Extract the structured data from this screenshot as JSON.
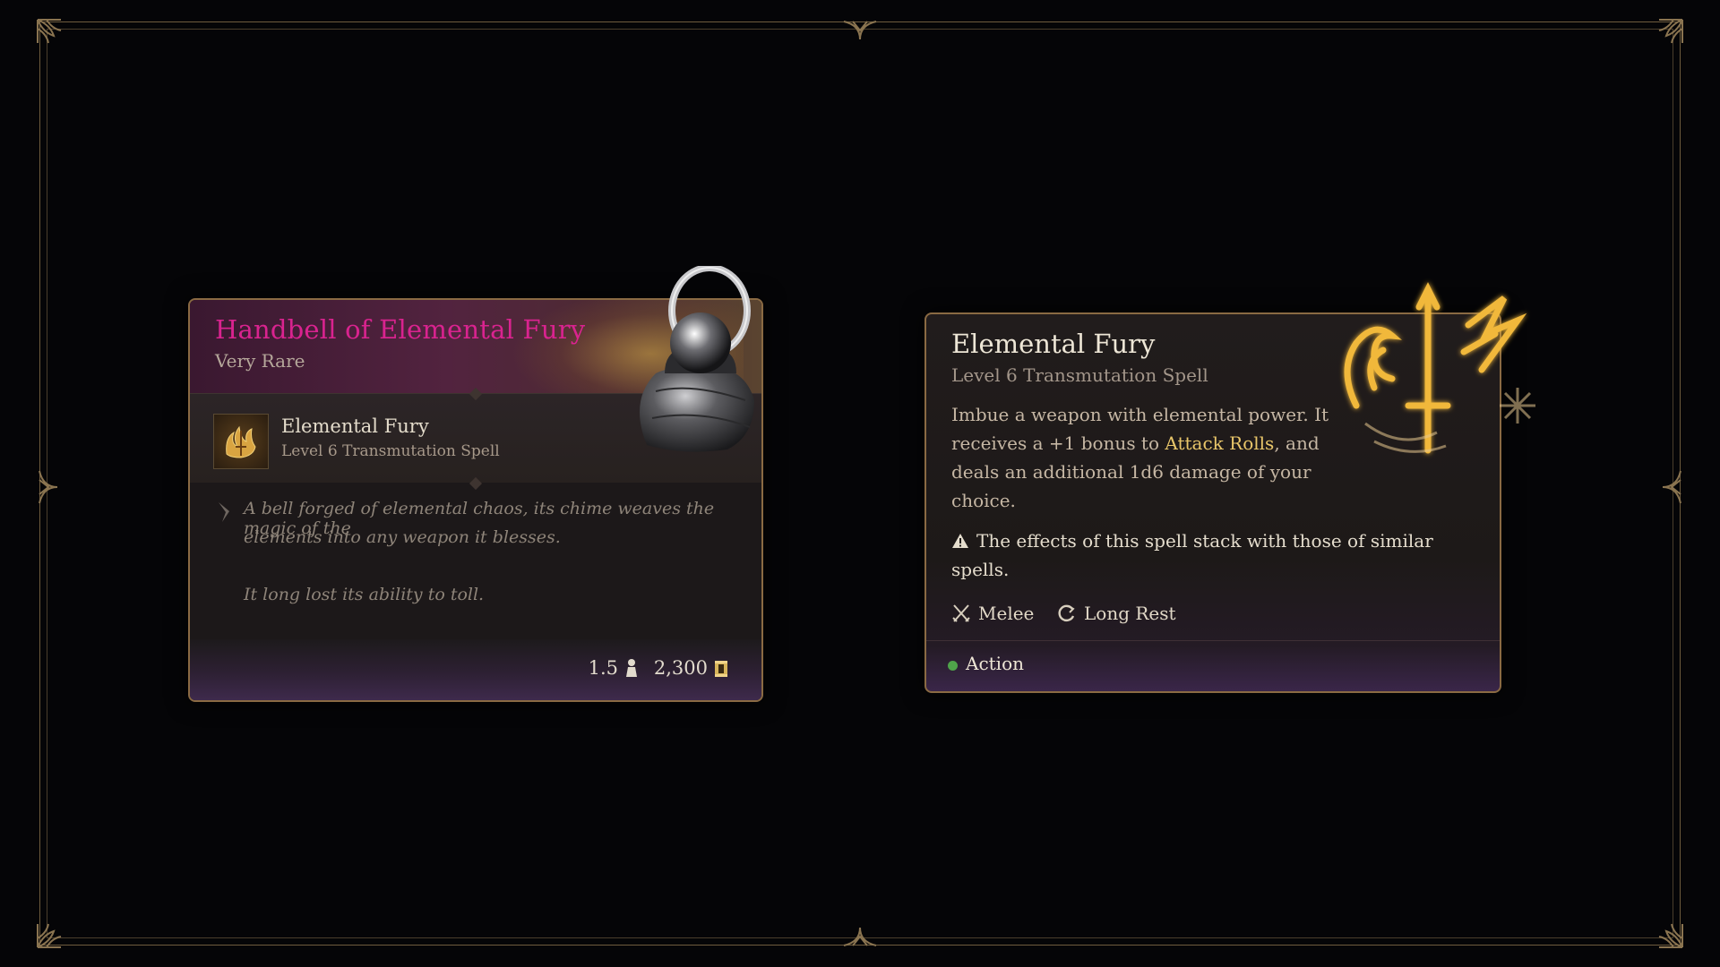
{
  "item_tooltip": {
    "title": "Handbell of Elemental Fury",
    "rarity": "Very Rare",
    "rarity_color": "#d9238f",
    "granted_spell": {
      "name": "Elemental Fury",
      "level": "Level 6 Transmutation Spell"
    },
    "description": [
      "A bell forged of elemental chaos, its chime weaves the magic of the",
      "elements into any weapon it blesses."
    ],
    "flavor": "It long lost its ability to toll.",
    "weight": "1.5",
    "value": "2,300",
    "icons": {
      "quill": "quill-icon",
      "weight": "weight-icon",
      "gold": "gold-coin-icon",
      "item": "handbell-icon",
      "spell": "elemental-fury-icon"
    }
  },
  "spell_tooltip": {
    "title": "Elemental Fury",
    "subtitle": "Level 6 Transmutation Spell",
    "body": {
      "line1": "Imbue a weapon with elemental power. It",
      "line2_pre": "receives a +1 bonus to ",
      "line2_link": "Attack Rolls",
      "line2_post": ", and",
      "line3": "deals an additional 1d6 damage of your",
      "line4": "choice."
    },
    "warning": {
      "line1": "The effects of this spell stack with those of similar",
      "line2": "spells."
    },
    "tags": [
      {
        "label": "Melee",
        "icon": "crossed-swords-icon"
      },
      {
        "label": "Long Rest",
        "icon": "long-rest-icon"
      }
    ],
    "cost": {
      "label": "Action",
      "color": "#4fa34a"
    },
    "highlight_color": "#e9c66a"
  }
}
